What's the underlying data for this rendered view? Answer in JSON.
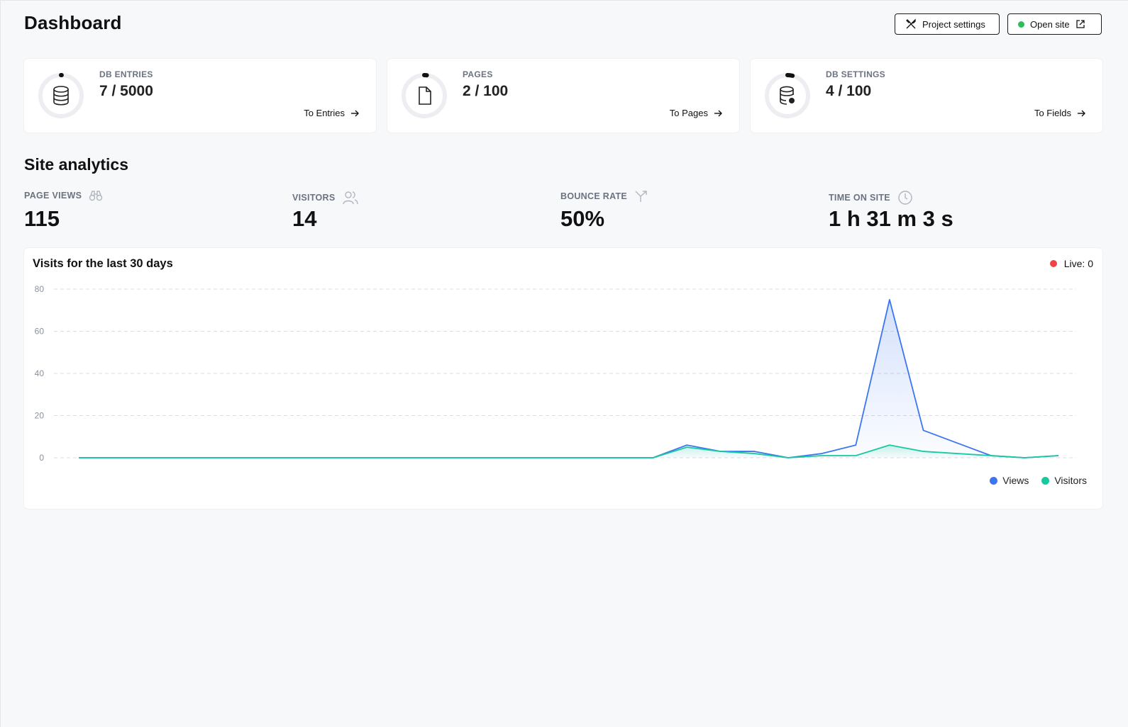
{
  "header": {
    "title": "Dashboard",
    "project_settings_label": "Project settings",
    "open_site_label": "Open site"
  },
  "cards": [
    {
      "label": "DB ENTRIES",
      "value": "7 / 5000",
      "link": "To Entries",
      "icon": "database-icon",
      "used": 7,
      "total": 5000
    },
    {
      "label": "PAGES",
      "value": "2 / 100",
      "link": "To Pages",
      "icon": "file-icon",
      "used": 2,
      "total": 100
    },
    {
      "label": "DB SETTINGS",
      "value": "4 / 100",
      "link": "To Fields",
      "icon": "database-settings-icon",
      "used": 4,
      "total": 100
    }
  ],
  "analytics": {
    "title": "Site analytics",
    "stats": [
      {
        "label": "PAGE VIEWS",
        "value": "115",
        "icon": "binoculars-icon"
      },
      {
        "label": "VISITORS",
        "value": "14",
        "icon": "users-icon"
      },
      {
        "label": "BOUNCE RATE",
        "value": "50%",
        "icon": "split-arrow-icon"
      },
      {
        "label": "TIME ON SITE",
        "value": "1 h 31 m 3 s",
        "icon": "clock-icon"
      }
    ]
  },
  "chart": {
    "title": "Visits for the last 30 days",
    "live_label": "Live: 0"
  },
  "colors": {
    "views": "#3b76f0",
    "visitors": "#18c9a0",
    "live": "#ef4444",
    "online": "#2fbd5a"
  },
  "chart_data": {
    "type": "area",
    "title": "Visits for the last 30 days",
    "xlabel": "",
    "ylabel": "",
    "ylim": [
      0,
      80
    ],
    "yticks": [
      0,
      20,
      40,
      60,
      80
    ],
    "grid": true,
    "legend": "bottom-right",
    "x": [
      1,
      2,
      3,
      4,
      5,
      6,
      7,
      8,
      9,
      10,
      11,
      12,
      13,
      14,
      15,
      16,
      17,
      18,
      19,
      20,
      21,
      22,
      23,
      24,
      25,
      26,
      27,
      28,
      29,
      30
    ],
    "series": [
      {
        "name": "Views",
        "values": [
          0,
          0,
          0,
          0,
          0,
          0,
          0,
          0,
          0,
          0,
          0,
          0,
          0,
          0,
          0,
          0,
          0,
          0,
          6,
          3,
          3,
          0,
          2,
          6,
          75,
          13,
          7,
          1,
          0,
          1
        ]
      },
      {
        "name": "Visitors",
        "values": [
          0,
          0,
          0,
          0,
          0,
          0,
          0,
          0,
          0,
          0,
          0,
          0,
          0,
          0,
          0,
          0,
          0,
          0,
          5,
          3,
          2,
          0,
          1,
          1,
          6,
          3,
          2,
          1,
          0,
          1
        ]
      }
    ]
  }
}
